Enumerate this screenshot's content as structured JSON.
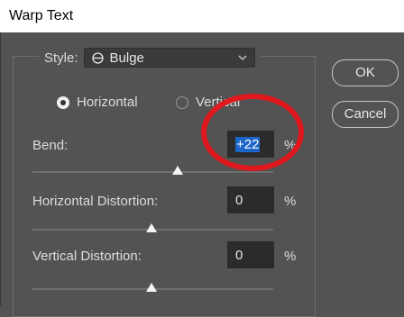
{
  "window": {
    "title": "Warp Text"
  },
  "style": {
    "label": "Style:",
    "selected": "Bulge",
    "icon": "bulge-icon"
  },
  "orientation": {
    "options": [
      {
        "label": "Horizontal",
        "selected": true
      },
      {
        "label": "Vertical",
        "selected": false
      }
    ]
  },
  "bend": {
    "label": "Bend:",
    "value": "+22",
    "unit": "%",
    "slider_percent": 22
  },
  "horizontal_distortion": {
    "label": "Horizontal Distortion:",
    "value": "0",
    "unit": "%",
    "slider_percent": 0
  },
  "vertical_distortion": {
    "label": "Vertical Distortion:",
    "value": "0",
    "unit": "%",
    "slider_percent": 0
  },
  "buttons": {
    "ok": "OK",
    "cancel": "Cancel"
  },
  "colors": {
    "dialog_bg": "#535353",
    "field_bg": "#2b2b2b",
    "selection": "#1c66c9",
    "annotation_ring": "#e0191f"
  }
}
